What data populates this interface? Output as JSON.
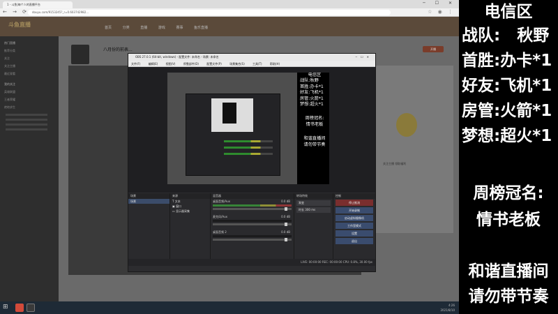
{
  "browser": {
    "tab_title": "1 - 斗鱼|每个人的直播平台",
    "url": "douyu.com/9153245?_r=0.603742982..."
  },
  "douyu": {
    "logo": "斗鱼直播",
    "nav": [
      "首页",
      "分类",
      "直播",
      "游戏",
      "赛事",
      "鱼乐直播"
    ],
    "stream_title": "八月份的前表...",
    "open_button": "开播",
    "right_tag": "关注主播 领取福利",
    "sidebar": [
      "热门直播",
      "推荐分类",
      "关注",
      "关注主播",
      "最近观看",
      "我的关注",
      "英雄联盟",
      "王者荣耀",
      "绝地求生"
    ]
  },
  "obs": {
    "title": "OBS 27.0.1 (64-bit, windows) - 配置文件: 未命名 - 场景: 未命名",
    "menu": [
      "文件(F)",
      "编辑(E)",
      "视图(V)",
      "停靠部件(D)",
      "配置文件(P)",
      "场景集合(S)",
      "工具(T)",
      "帮助(H)"
    ],
    "scenes_header": "场景",
    "scene_item": "场景",
    "sources_header": "来源",
    "sources": [
      "文本",
      "窗口",
      "显示器采集"
    ],
    "mixer_header": "混音器",
    "mixer_channels": [
      {
        "name": "桌面音频/Aux",
        "db": "0.0 dB"
      },
      {
        "name": "麦克风/Aux",
        "db": "0.0 dB"
      },
      {
        "name": "桌面音频 2",
        "db": "0.0 dB"
      }
    ],
    "transitions_header": "转场特效",
    "transition_type": "渐变",
    "duration_label": "时长",
    "duration_value": "300 ms",
    "controls_header": "控制",
    "controls": [
      "停止推流",
      "开始录制",
      "启动虚拟摄像机",
      "工作室模式",
      "设置",
      "退出"
    ],
    "status": "LIVE: 00:00:00   REC: 00:00:00   CPU: 0.8%, 30.00 fps"
  },
  "overlay": {
    "region": "电信区",
    "team_label": "战队:",
    "team_value": "秋野",
    "first_win_label": "首胜:",
    "first_win_value": "办卡*1",
    "friend_label": "好友:",
    "friend_value": "飞机*1",
    "room_admin_label": "房管:",
    "room_admin_value": "火箭*1",
    "dream_label": "梦想:",
    "dream_value": "超火*1",
    "weekly_title": "周榜冠名:",
    "weekly_name": "情书老板",
    "notice_1": "和谐直播间",
    "notice_2": "请勿带节奏"
  },
  "taskbar": {
    "time": "4:26",
    "date": "2021/8/10"
  }
}
